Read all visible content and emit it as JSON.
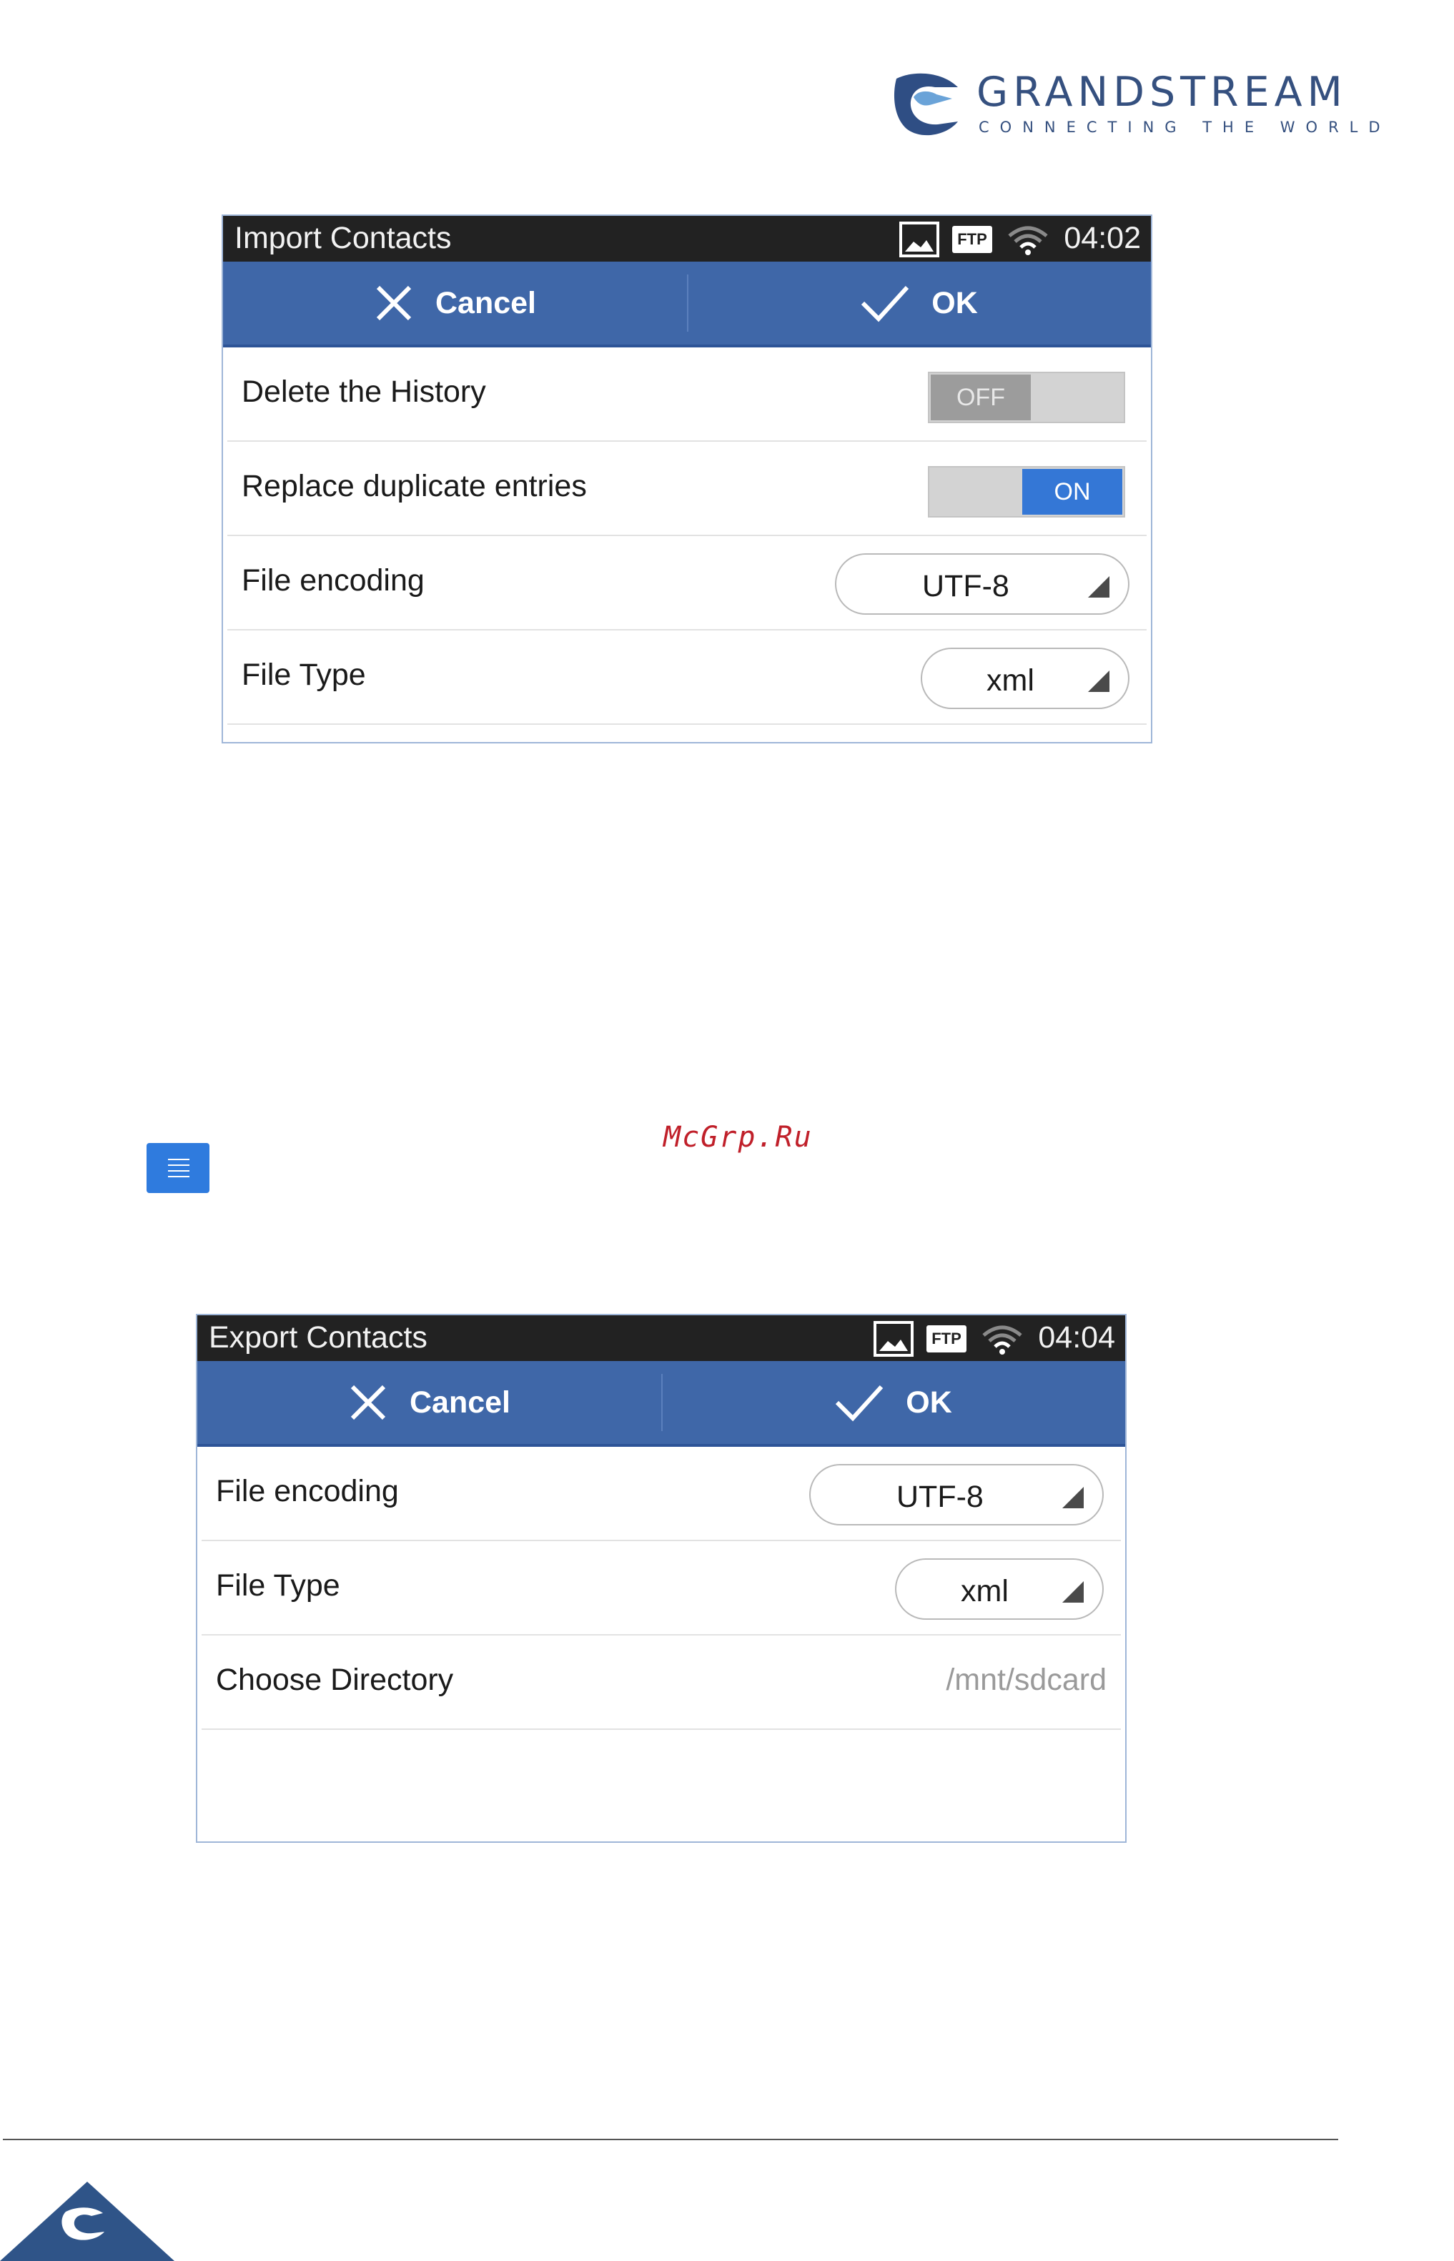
{
  "brand": {
    "name": "GRANDSTREAM",
    "tagline": "CONNECTING THE WORLD",
    "color": "#35507f"
  },
  "import_screen": {
    "title": "Import Contacts",
    "time": "04:02",
    "status_icons": [
      "image-icon",
      "ftp-icon",
      "wifi-icon"
    ],
    "ftp_label": "FTP",
    "cancel_label": "Cancel",
    "ok_label": "OK",
    "rows": [
      {
        "label": "Delete the History",
        "control": "toggle",
        "state": "OFF"
      },
      {
        "label": "Replace duplicate entries",
        "control": "toggle",
        "state": "ON"
      },
      {
        "label": "File encoding",
        "control": "select",
        "value": "UTF-8"
      },
      {
        "label": "File Type",
        "control": "select",
        "value": "xml"
      }
    ]
  },
  "export_screen": {
    "title": "Export Contacts",
    "time": "04:04",
    "status_icons": [
      "image-icon",
      "ftp-icon",
      "wifi-icon"
    ],
    "ftp_label": "FTP",
    "cancel_label": "Cancel",
    "ok_label": "OK",
    "rows": [
      {
        "label": "File encoding",
        "control": "select",
        "value": "UTF-8"
      },
      {
        "label": "File Type",
        "control": "select",
        "value": "xml"
      },
      {
        "label": "Choose Directory",
        "control": "text",
        "value": "/mnt/sdcard"
      }
    ]
  },
  "watermark": "McGrp.Ru",
  "menu_icon": "menu-icon",
  "colors": {
    "action_bar": "#3f67a8",
    "status_bar": "#222222",
    "toggle_on": "#3477d6",
    "toggle_off": "#9c9c9c",
    "watermark": "#c0202a"
  }
}
